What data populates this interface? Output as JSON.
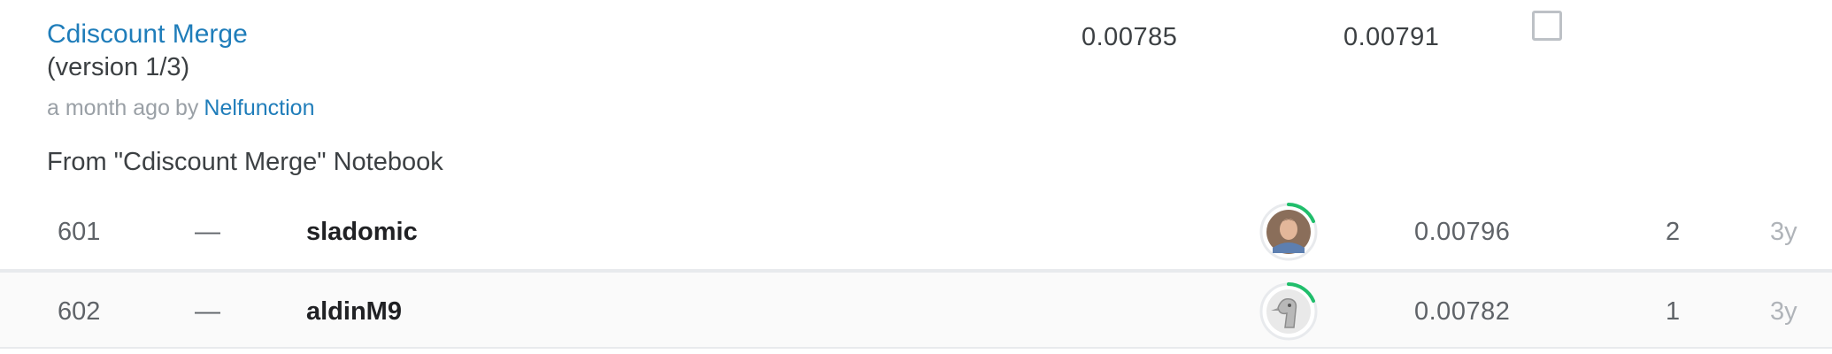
{
  "submission": {
    "title": "Cdiscount Merge",
    "version": "(version 1/3)",
    "time_ago": "a month ago",
    "by_label": "by",
    "author": "Nelfunction",
    "private_score": "0.00785",
    "public_score": "0.00791",
    "selected": false,
    "source": "From \"Cdiscount Merge\" Notebook"
  },
  "leaderboard": {
    "rows": [
      {
        "rank": "601",
        "delta": "—",
        "team": "sladomic",
        "avatar": "user-photo-avatar",
        "score": "0.00796",
        "entries": "2",
        "last": "3y"
      },
      {
        "rank": "602",
        "delta": "—",
        "team": "aldinM9",
        "avatar": "bird-sketch-avatar",
        "score": "0.00782",
        "entries": "1",
        "last": "3y"
      }
    ]
  },
  "colors": {
    "link": "#1f7dba",
    "progress_ring": "#20be6b",
    "row_border": "#e8eaed"
  }
}
